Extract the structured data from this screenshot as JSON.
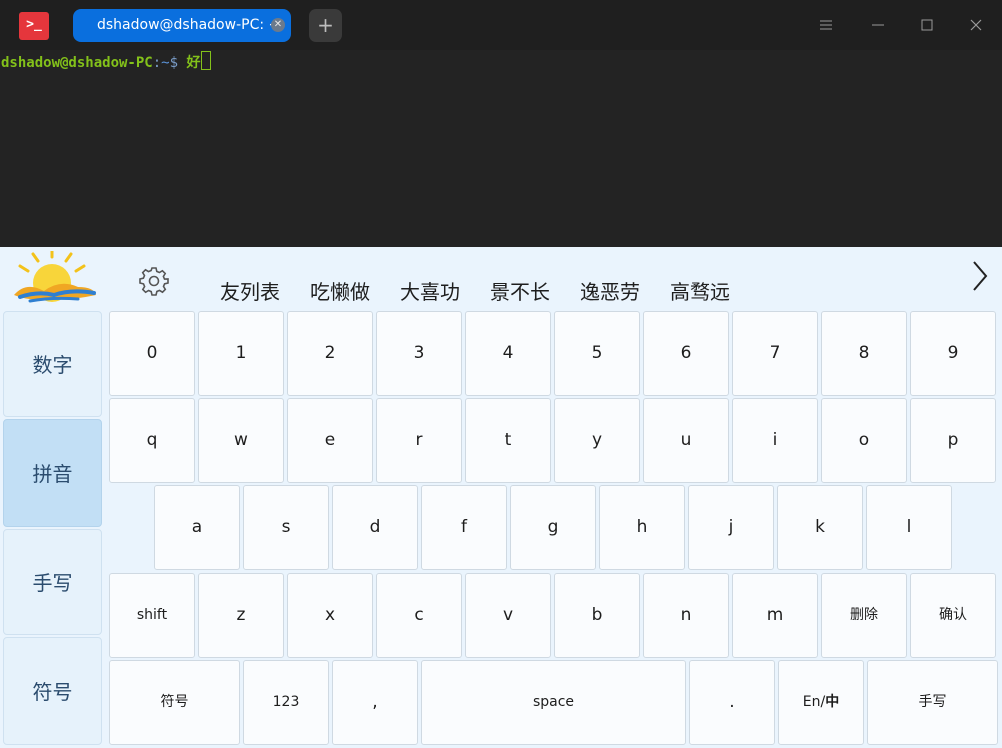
{
  "terminal": {
    "tab_title": "dshadow@dshadow-PC: ~",
    "new_tab_glyph": "+",
    "prompt_user": "dshadow@dshadow-PC",
    "prompt_sep": ":",
    "prompt_path": "~",
    "prompt_symbol": "$",
    "input_text": "好",
    "icons": {
      "app": "terminal-icon",
      "close_tab": "close-icon",
      "menu": "hamburger-menu-icon",
      "minimize": "minimize-icon",
      "maximize": "maximize-icon",
      "close": "close-window-icon"
    },
    "colors": {
      "tab_accent": "#0a6fde",
      "prompt_green": "#83c11a",
      "app_icon": "#e5363c"
    }
  },
  "ime": {
    "candidates": [
      "友列表",
      "吃懒做",
      "大喜功",
      "景不长",
      "逸恶劳",
      "高骛远"
    ],
    "modes": {
      "numbers": "数字",
      "pinyin": "拼音",
      "handwriting": "手写",
      "symbols": "符号"
    },
    "active_mode": "拼音",
    "row_digits": [
      "0",
      "1",
      "2",
      "3",
      "4",
      "5",
      "6",
      "7",
      "8",
      "9"
    ],
    "row_top": [
      "q",
      "w",
      "e",
      "r",
      "t",
      "y",
      "u",
      "i",
      "o",
      "p"
    ],
    "row_home": [
      "a",
      "s",
      "d",
      "f",
      "g",
      "h",
      "j",
      "k",
      "l"
    ],
    "row_bottom": {
      "shift": "shift",
      "letters": [
        "z",
        "x",
        "c",
        "v",
        "b",
        "n",
        "m"
      ],
      "delete": "删除",
      "confirm": "确认"
    },
    "row_space": {
      "symbols": "符号",
      "numbers": "123",
      "comma": ",",
      "space": "space",
      "period": ".",
      "lang_en": "En/",
      "lang_zh": "中",
      "handwriting": "手写"
    },
    "colors": {
      "panel_bg": "#eaf4fd",
      "active_mode_bg": "#c2dff5",
      "mode_text": "#2b4c6e"
    }
  }
}
